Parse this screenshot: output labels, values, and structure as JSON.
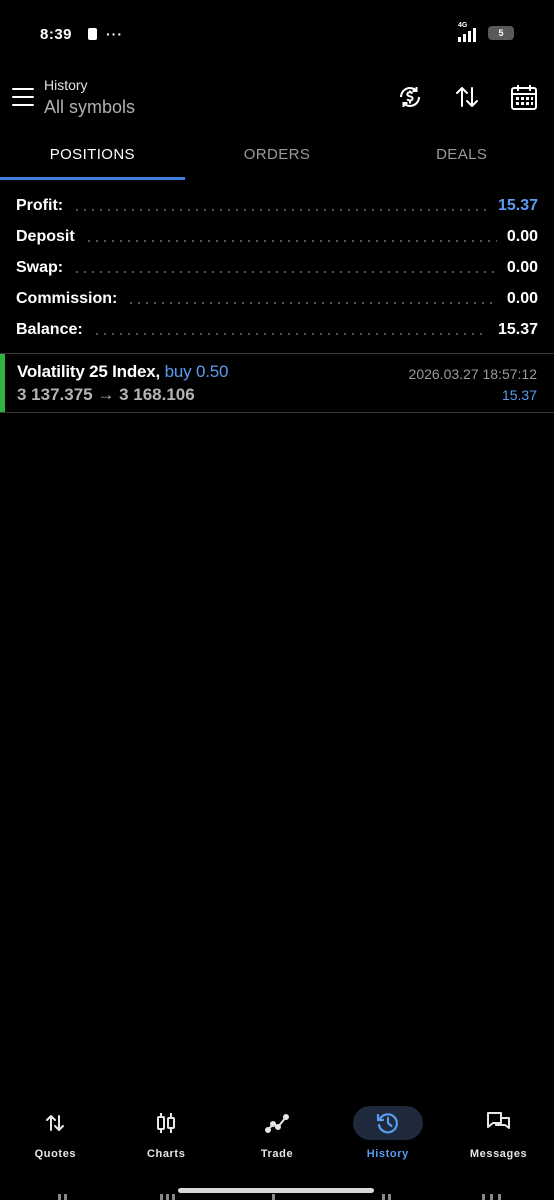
{
  "status_bar": {
    "time": "8:39",
    "network": "4G",
    "battery": "5"
  },
  "header": {
    "title": "History",
    "subtitle": "All symbols"
  },
  "tabs": [
    {
      "label": "POSITIONS",
      "active": true
    },
    {
      "label": "ORDERS",
      "active": false
    },
    {
      "label": "DEALS",
      "active": false
    }
  ],
  "summary": {
    "profit": {
      "label": "Profit:",
      "value": "15.37"
    },
    "deposit": {
      "label": "Deposit",
      "value": "0.00"
    },
    "swap": {
      "label": "Swap:",
      "value": "0.00"
    },
    "commission": {
      "label": "Commission:",
      "value": "0.00"
    },
    "balance": {
      "label": "Balance:",
      "value": "15.37"
    }
  },
  "position": {
    "symbol": "Volatility 25 Index,",
    "side": "buy 0.50",
    "prices": "3 137.375 → 3 168.106",
    "time": "2026.03.27 18:57:12",
    "profit": "15.37"
  },
  "bottom_nav": [
    {
      "label": "Quotes",
      "icon": "quotes-icon",
      "active": false
    },
    {
      "label": "Charts",
      "icon": "charts-icon",
      "active": false
    },
    {
      "label": "Trade",
      "icon": "trade-icon",
      "active": false
    },
    {
      "label": "History",
      "icon": "history-icon",
      "active": true
    },
    {
      "label": "Messages",
      "icon": "messages-icon",
      "active": false
    }
  ],
  "colors": {
    "accent": "#5b9bf0",
    "profit_strip": "#2fb53f",
    "background": "#000000"
  }
}
